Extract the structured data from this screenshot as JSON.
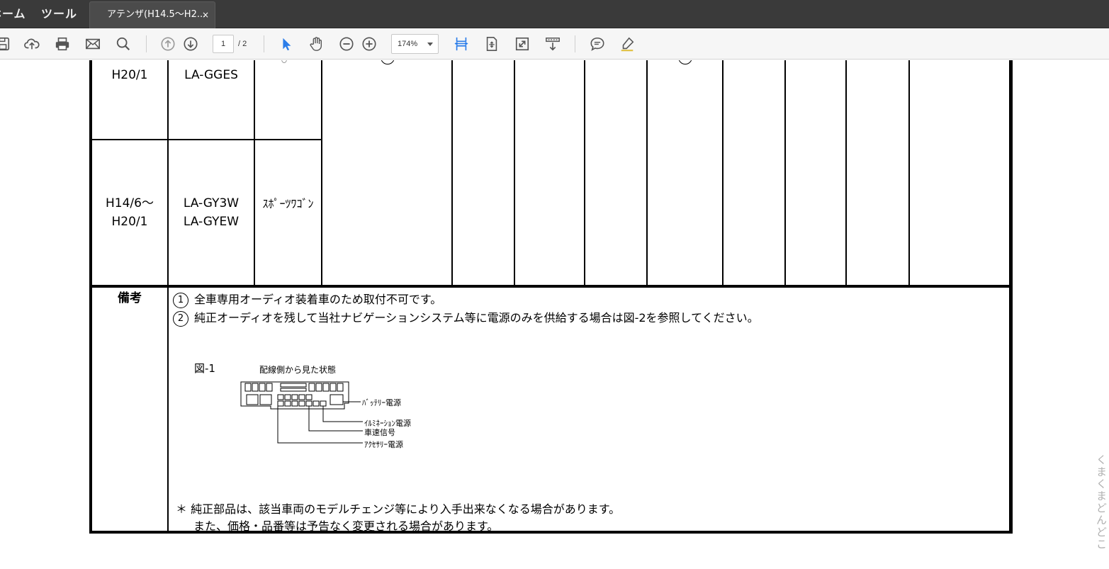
{
  "app": {
    "menu": {
      "home": "ホーム",
      "tools": "ツール"
    },
    "tab": {
      "title": "アテンザ(H14.5〜H2...",
      "close": "×"
    }
  },
  "toolbar": {
    "page_current": "1",
    "page_total": "/ 2",
    "zoom": "174%",
    "icons": [
      "save-icon",
      "upload-icon",
      "print-icon",
      "mail-icon",
      "search-icon",
      "page-up-icon",
      "page-down-icon",
      "select-cursor-icon",
      "hand-icon",
      "zoom-out-icon",
      "zoom-in-icon",
      "fit-width-icon",
      "rotate-page-icon",
      "fullscreen-icon",
      "scroll-mode-icon",
      "comment-icon",
      "highlight-icon"
    ],
    "colors": {
      "tabbar_bg": "#3a3a3a",
      "toolbar_bg": "#f6f6f6",
      "accent": "#2b7de9"
    }
  },
  "table": {
    "rows": [
      {
        "period": "H20/1",
        "model": "LA-GGES",
        "body": ""
      },
      {
        "period": [
          "H14/6〜",
          "H20/1"
        ],
        "model": [
          "LA-GY3W",
          "LA-GYEW"
        ],
        "body": "ｽﾎﾟｰﾂﾜｺﾞﾝ"
      }
    ],
    "remarks_label": "備考",
    "notes": [
      {
        "num": "1",
        "text": "全車専用オーディオ装着車のため取付不可です。"
      },
      {
        "num": "2",
        "text": "純正オーディオを残して当社ナビゲーションシステム等に電源のみを供給する場合は図-2を参照してください。"
      }
    ],
    "figure": {
      "label": "図-1",
      "caption": "配線側から見た状態",
      "callouts": [
        "ﾊﾞｯﾃﾘｰ電源",
        "ｲﾙﾐﾈｰｼｮﾝ電源",
        "車速信号",
        "ｱｸｾｻﾘｰ電源"
      ]
    },
    "footnotes": [
      "＊ 純正部品は、該当車両のモデルチェンジ等により入手出来なくなる場合があります。",
      "また、価格・品番等は予告なく変更される場合があります。"
    ]
  },
  "watermark": "くまくまどんどこ"
}
